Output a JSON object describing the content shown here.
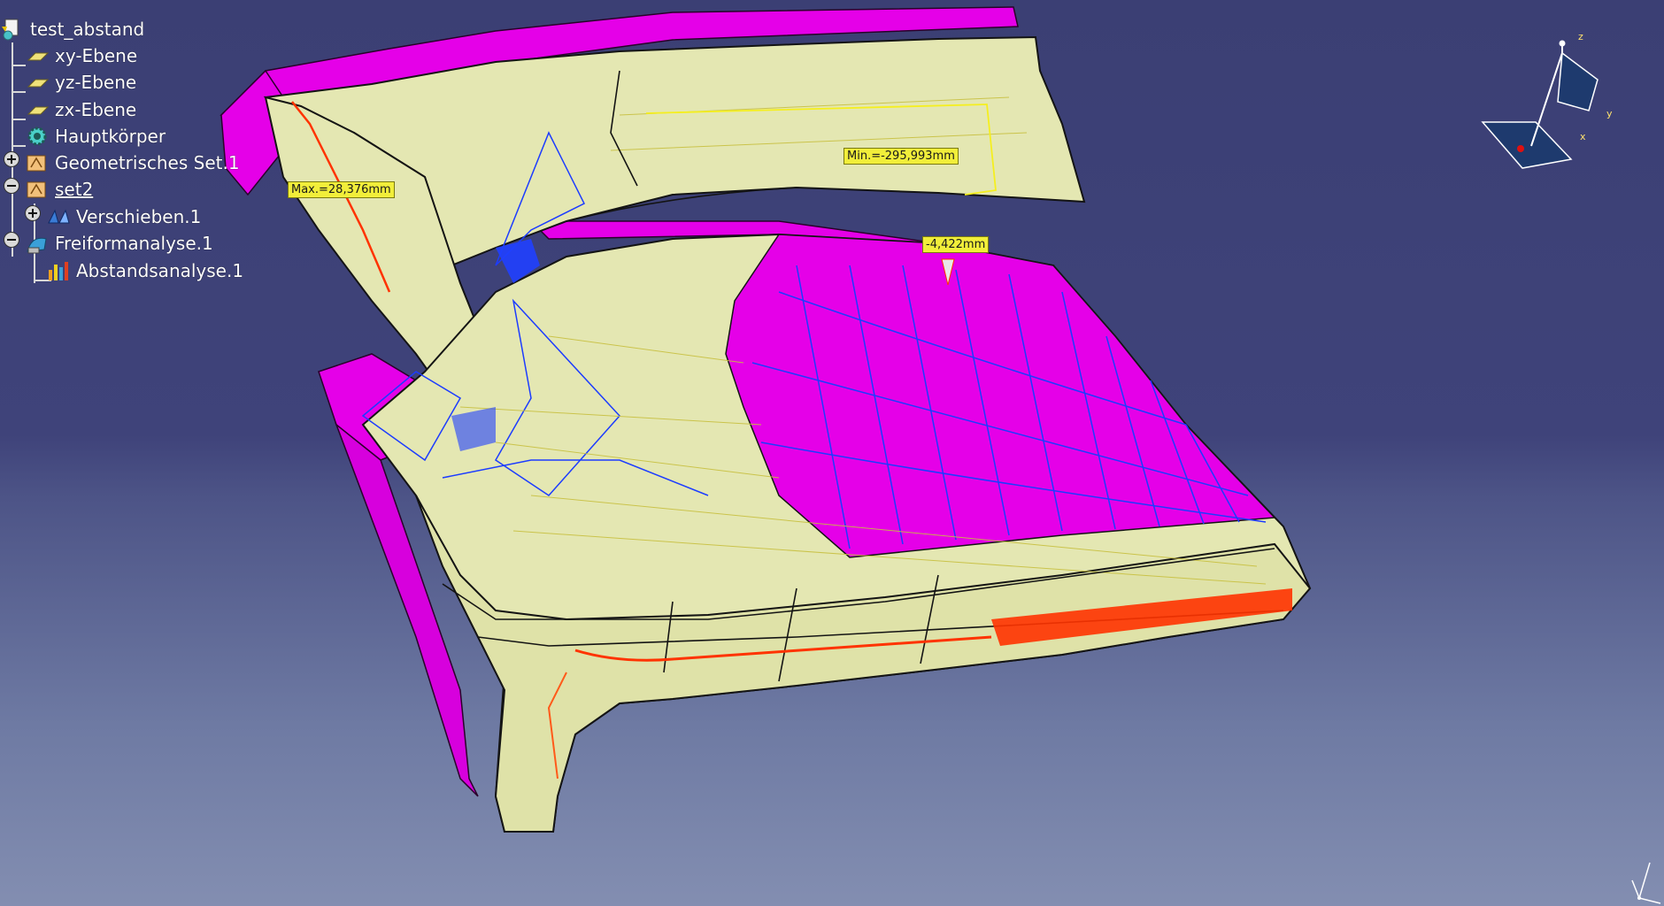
{
  "tree": {
    "root": "test_abstand",
    "items": [
      {
        "label": "xy-Ebene"
      },
      {
        "label": "yz-Ebene"
      },
      {
        "label": "zx-Ebene"
      },
      {
        "label": "Hauptkörper"
      },
      {
        "label": "Geometrisches Set.1"
      },
      {
        "label": "set2"
      },
      {
        "label": "Verschieben.1"
      },
      {
        "label": "Freiformanalyse.1"
      },
      {
        "label": "Abstandsanalyse.1"
      }
    ]
  },
  "annotations": {
    "max": "Max.=28,376mm",
    "min": "Min.=-295,993mm",
    "point": "-4,422mm"
  },
  "compass": {
    "x": "x",
    "y": "y",
    "z": "z"
  },
  "colors": {
    "background_top": "#3b3f74",
    "background_bottom": "#838eb1",
    "surface": "#e4e7b2",
    "magenta": "#e500e8",
    "analysis_blue": "#1c3cff",
    "analysis_yellow": "#f5ef1f",
    "analysis_red": "#ff3300",
    "annotation_bg": "#f1ee3a"
  }
}
